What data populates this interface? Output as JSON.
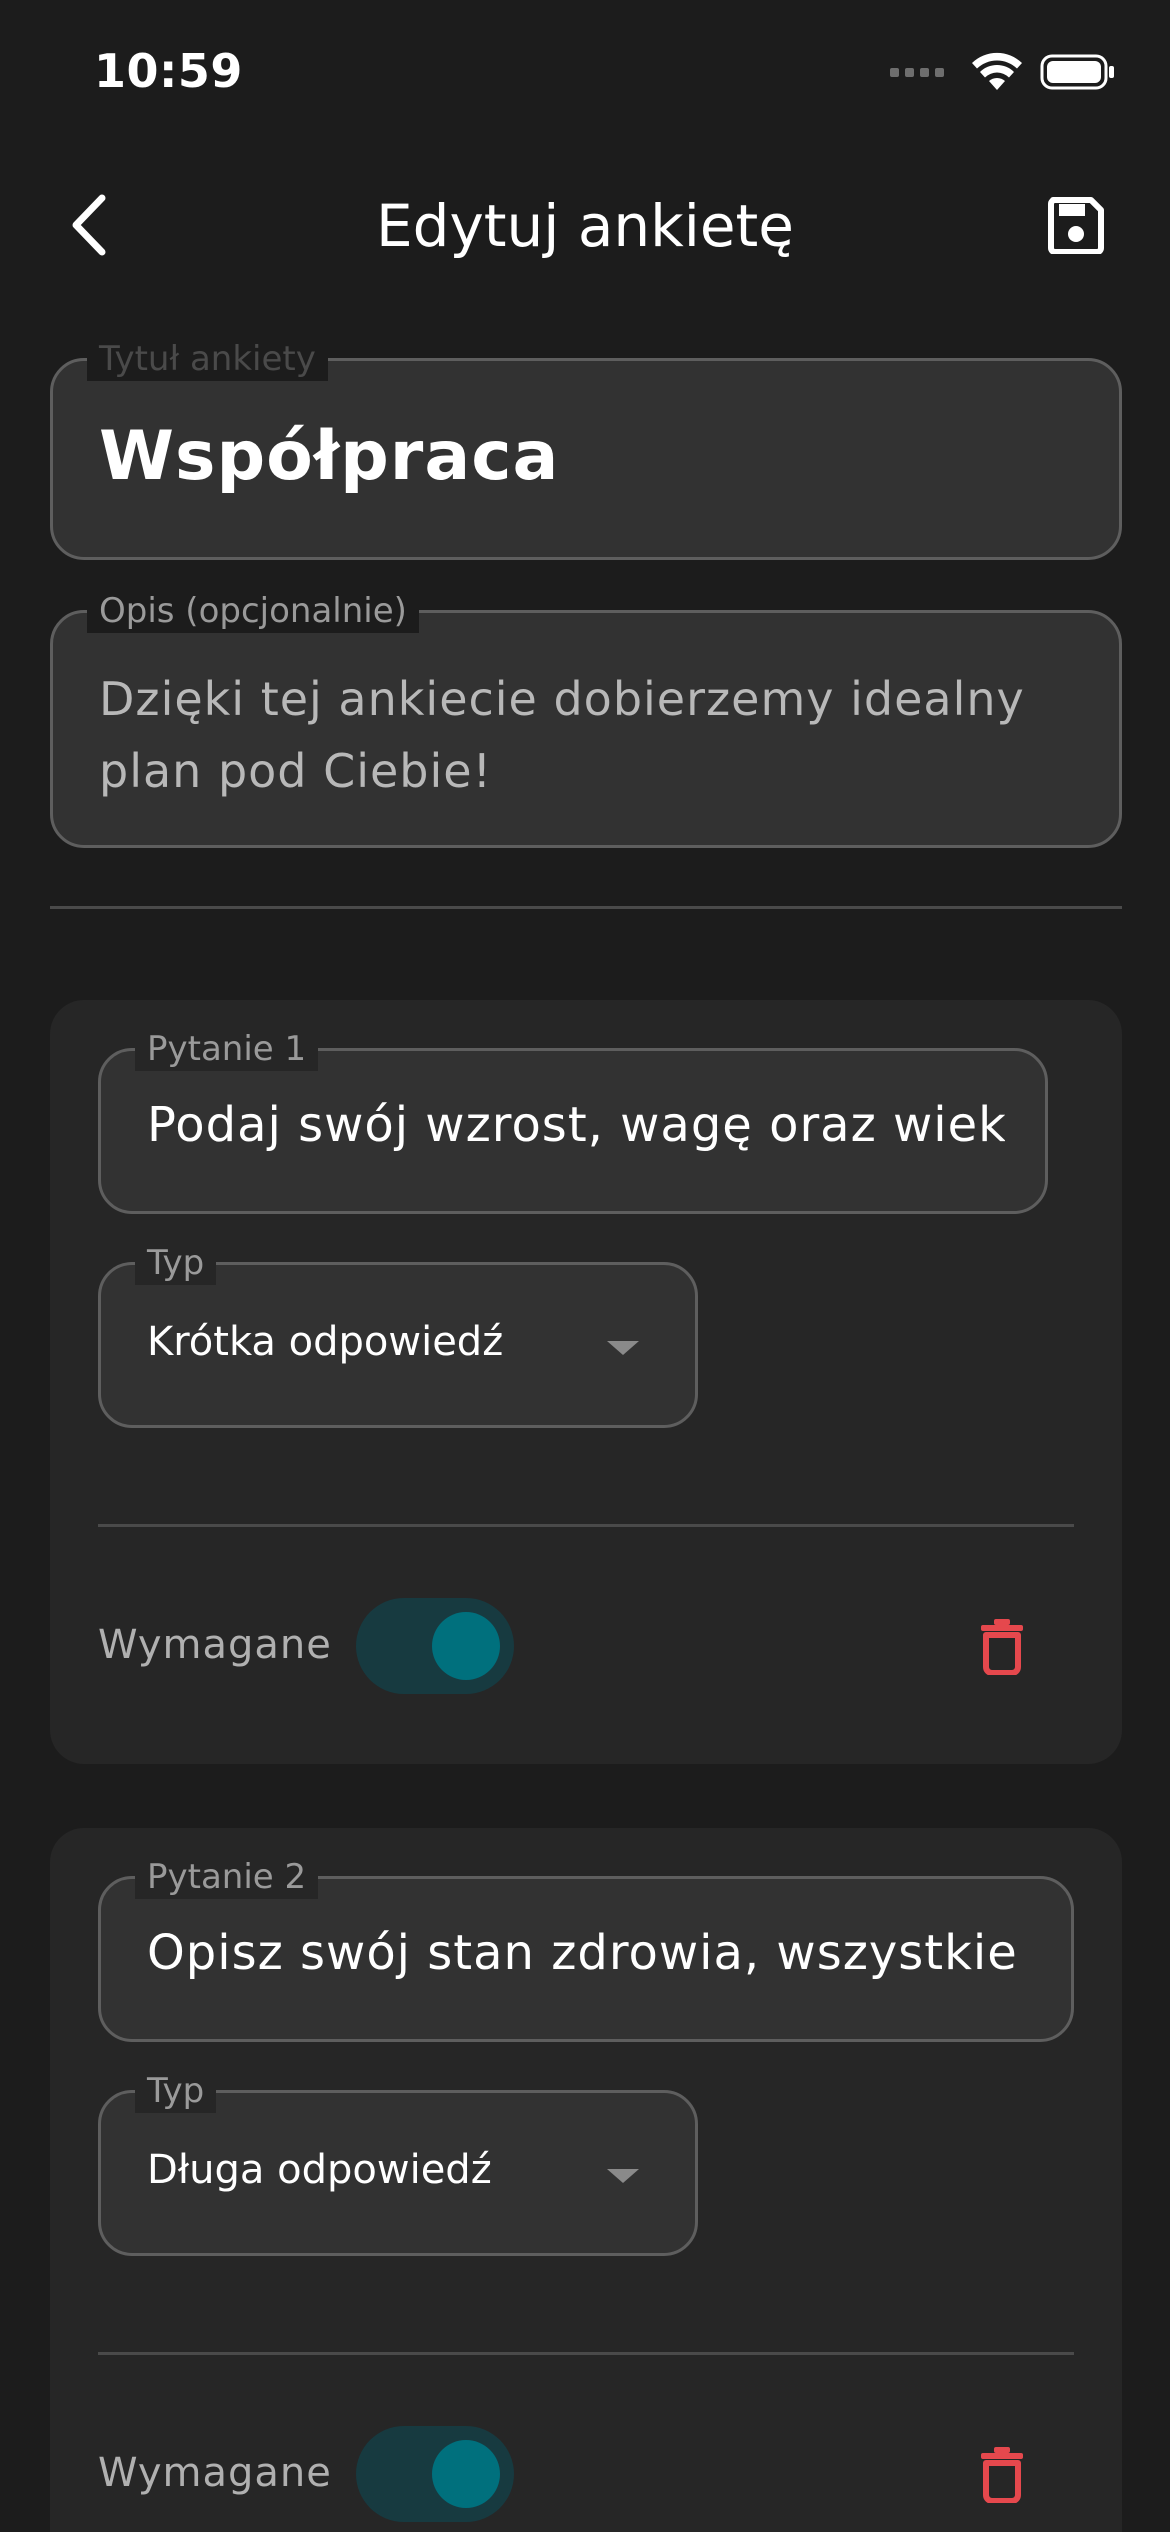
{
  "status_bar": {
    "time": "10:59"
  },
  "header": {
    "title": "Edytuj ankietę"
  },
  "survey": {
    "title_label": "Tytuł ankiety",
    "title_value": "Współpraca",
    "description_label": "Opis (opcjonalnie)",
    "description_value": "Dzięki tej ankiecie dobierzemy idealny plan pod Ciebie!"
  },
  "questions": [
    {
      "label": "Pytanie 1",
      "value": "Podaj swój wzrost, wagę oraz wiek.",
      "type_label": "Typ",
      "type_value": "Krótka odpowiedź",
      "required_label": "Wymagane",
      "required": true
    },
    {
      "label": "Pytanie 2",
      "value": "Opisz swój stan zdrowia, wszystkie c",
      "type_label": "Typ",
      "type_value": "Długa odpowiedź",
      "required_label": "Wymagane",
      "required": true
    }
  ],
  "colors": {
    "background": "#1c1c1c",
    "card": "#262626",
    "toggle_track": "#173a40",
    "toggle_knob": "#00707d",
    "delete": "#e5484d"
  },
  "icons": {
    "back": "chevron-left-icon",
    "save": "floppy-disk-icon",
    "delete": "trash-icon",
    "wifi": "wifi-icon",
    "battery": "battery-icon"
  }
}
